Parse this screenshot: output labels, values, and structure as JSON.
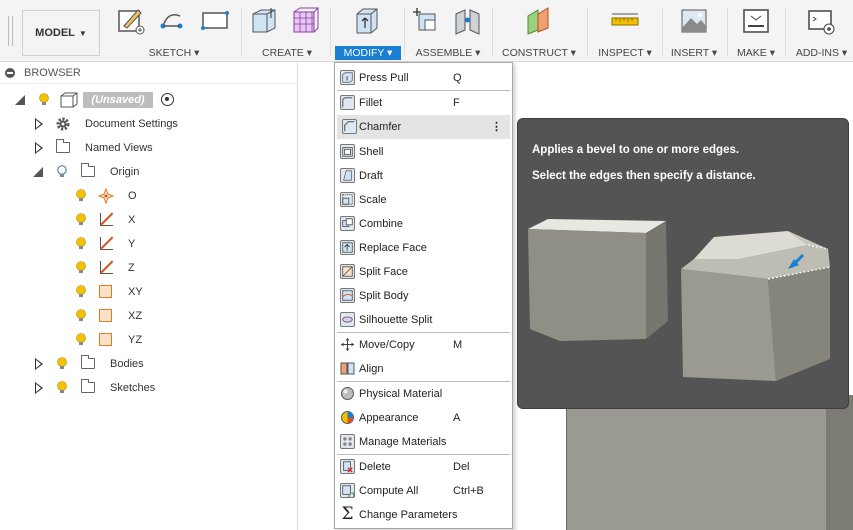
{
  "toolbar": {
    "workspace": "MODEL",
    "groups": [
      {
        "label": "SKETCH ▾"
      },
      {
        "label": "CREATE ▾"
      },
      {
        "label": "MODIFY ▾"
      },
      {
        "label": "ASSEMBLE ▾"
      },
      {
        "label": "CONSTRUCT ▾"
      },
      {
        "label": "INSPECT ▾"
      },
      {
        "label": "INSERT ▾"
      },
      {
        "label": "MAKE ▾"
      },
      {
        "label": "ADD-INS ▾"
      }
    ]
  },
  "browser": {
    "title": "BROWSER",
    "root": "(Unsaved)",
    "items": [
      {
        "label": "Document Settings"
      },
      {
        "label": "Named Views"
      },
      {
        "label": "Origin"
      },
      {
        "label": "O"
      },
      {
        "label": "X"
      },
      {
        "label": "Y"
      },
      {
        "label": "Z"
      },
      {
        "label": "XY"
      },
      {
        "label": "XZ"
      },
      {
        "label": "YZ"
      },
      {
        "label": "Bodies"
      },
      {
        "label": "Sketches"
      }
    ]
  },
  "menu": {
    "items": [
      {
        "label": "Press Pull",
        "key": "Q"
      },
      {
        "label": "Fillet",
        "key": "F"
      },
      {
        "label": "Chamfer",
        "key": ""
      },
      {
        "label": "Shell",
        "key": ""
      },
      {
        "label": "Draft",
        "key": ""
      },
      {
        "label": "Scale",
        "key": ""
      },
      {
        "label": "Combine",
        "key": ""
      },
      {
        "label": "Replace Face",
        "key": ""
      },
      {
        "label": "Split Face",
        "key": ""
      },
      {
        "label": "Split Body",
        "key": ""
      },
      {
        "label": "Silhouette Split",
        "key": ""
      },
      {
        "label": "Move/Copy",
        "key": "M"
      },
      {
        "label": "Align",
        "key": ""
      },
      {
        "label": "Physical Material",
        "key": ""
      },
      {
        "label": "Appearance",
        "key": "A"
      },
      {
        "label": "Manage Materials",
        "key": ""
      },
      {
        "label": "Delete",
        "key": "Del"
      },
      {
        "label": "Compute All",
        "key": "Ctrl+B"
      },
      {
        "label": "Change Parameters",
        "key": ""
      }
    ]
  },
  "tooltip": {
    "line1": "Applies a bevel to one or more edges.",
    "line2": "Select the edges then specify a distance."
  },
  "colors": {
    "accent": "#1a7fd1",
    "tooltip_bg": "#555454",
    "bulb": "#f2c200"
  }
}
